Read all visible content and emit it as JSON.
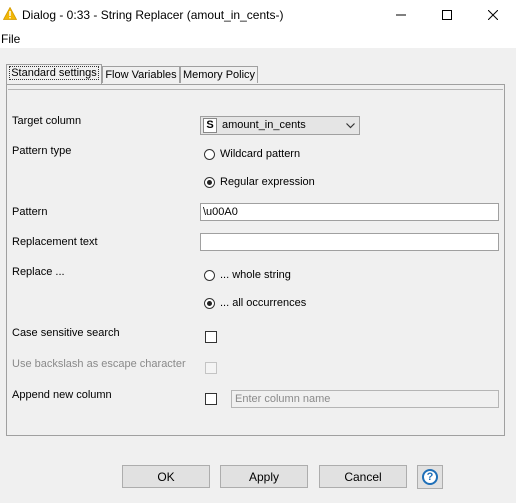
{
  "window": {
    "title": "Dialog - 0:33 - String Replacer (amout_in_cents-)",
    "icon": "warning-triangle-icon",
    "controls": [
      "minimize-icon",
      "maximize-icon",
      "close-icon"
    ]
  },
  "menu": {
    "file": "File"
  },
  "tabs": [
    {
      "label": "Standard settings",
      "active": true
    },
    {
      "label": "Flow Variables",
      "active": false
    },
    {
      "label": "Memory Policy",
      "active": false
    }
  ],
  "form": {
    "target_column": {
      "label": "Target column",
      "type_badge": "S",
      "value": "amount_in_cents"
    },
    "pattern_type": {
      "label": "Pattern type",
      "options": [
        {
          "label": "Wildcard pattern",
          "selected": false
        },
        {
          "label": "Regular expression",
          "selected": true
        }
      ]
    },
    "pattern": {
      "label": "Pattern",
      "value": "\\u00A0"
    },
    "replacement": {
      "label": "Replacement text",
      "value": ""
    },
    "replace": {
      "label": "Replace ...",
      "options": [
        {
          "label": "... whole string",
          "selected": false
        },
        {
          "label": "... all occurrences",
          "selected": true
        }
      ]
    },
    "case_sensitive": {
      "label": "Case sensitive search",
      "checked": false
    },
    "backslash_escape": {
      "label": "Use backslash as escape character",
      "checked": false,
      "enabled": false
    },
    "append_column": {
      "label": "Append new column",
      "checked": false,
      "placeholder": "Enter column name"
    }
  },
  "buttons": {
    "ok": "OK",
    "apply": "Apply",
    "cancel": "Cancel",
    "help": "?"
  },
  "colors": {
    "help_blue": "#1e6fb8",
    "warning_yellow": "#f2b705",
    "dialog_bg": "#f0f0f0"
  }
}
